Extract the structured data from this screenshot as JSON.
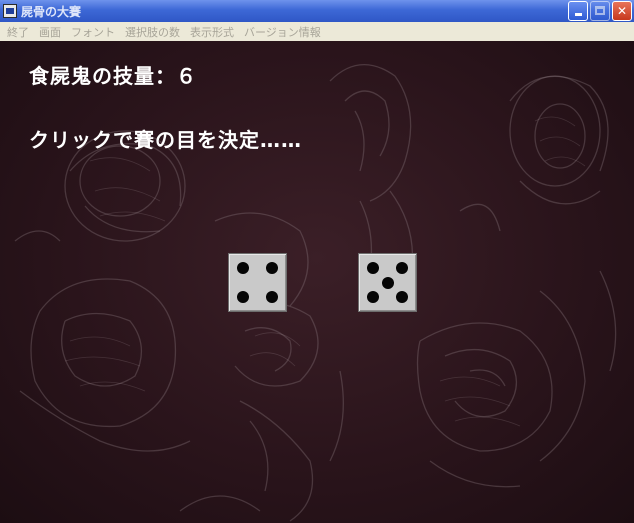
{
  "window": {
    "title": "屍骨の大賽",
    "buttons": {
      "minimize": "minimize",
      "maximize": "maximize",
      "close": "✕"
    }
  },
  "menu": {
    "items": [
      "終了",
      "画面",
      "フォント",
      "選択肢の数",
      "表示形式",
      "バージョン情報"
    ]
  },
  "game": {
    "skill_text": "食屍鬼の技量：６",
    "prompt_text": "クリックで賽の目を決定……",
    "dice": [
      {
        "value": 4
      },
      {
        "value": 5
      }
    ]
  },
  "colors": {
    "background": "#2a141b",
    "text": "#ffffff",
    "die_face": "#c9c9c9",
    "pip": "#050505",
    "titlebar": "#3d68d6",
    "menubar": "#ece9d8"
  }
}
